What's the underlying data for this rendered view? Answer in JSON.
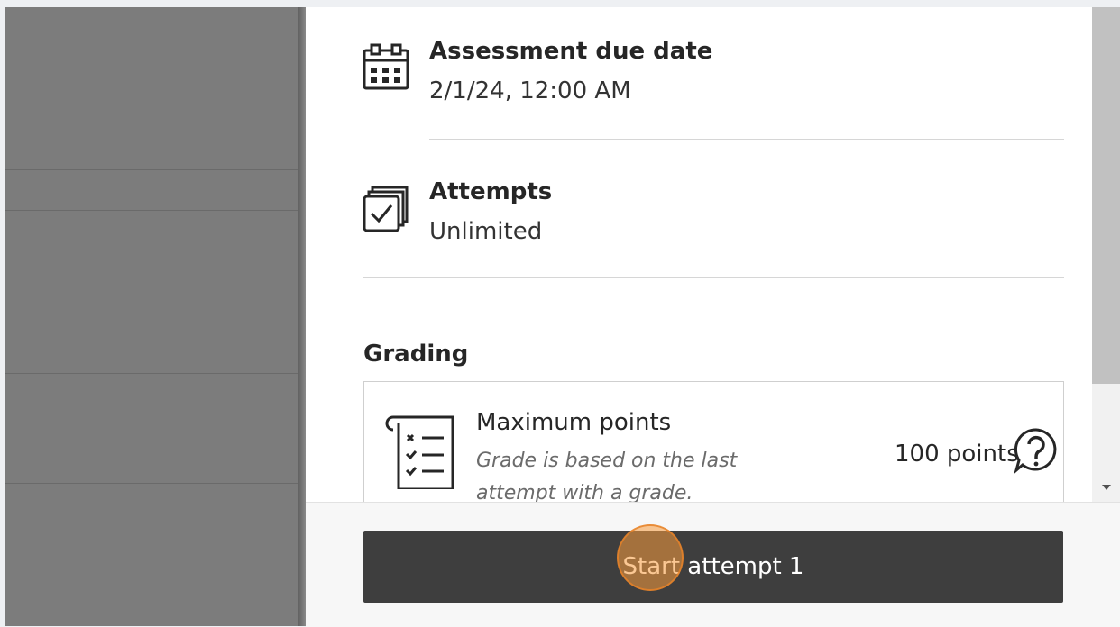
{
  "due_date": {
    "icon": "calendar-icon",
    "title": "Assessment due date",
    "value": "2/1/24, 12:00 AM"
  },
  "attempts": {
    "icon": "attempts-checkbox-icon",
    "title": "Attempts",
    "value": "Unlimited"
  },
  "grading": {
    "heading": "Grading",
    "icon": "grading-checklist-icon",
    "title": "Maximum points",
    "description": "Grade is based on the last attempt with a grade.",
    "points": "100 points"
  },
  "help": {
    "icon": "help-question-icon"
  },
  "footer": {
    "start_button_label": "Start attempt 1"
  },
  "colors": {
    "button": "#3e3e3e",
    "overlay": "#7c7c7c",
    "click_highlight": "#f79b3c"
  }
}
